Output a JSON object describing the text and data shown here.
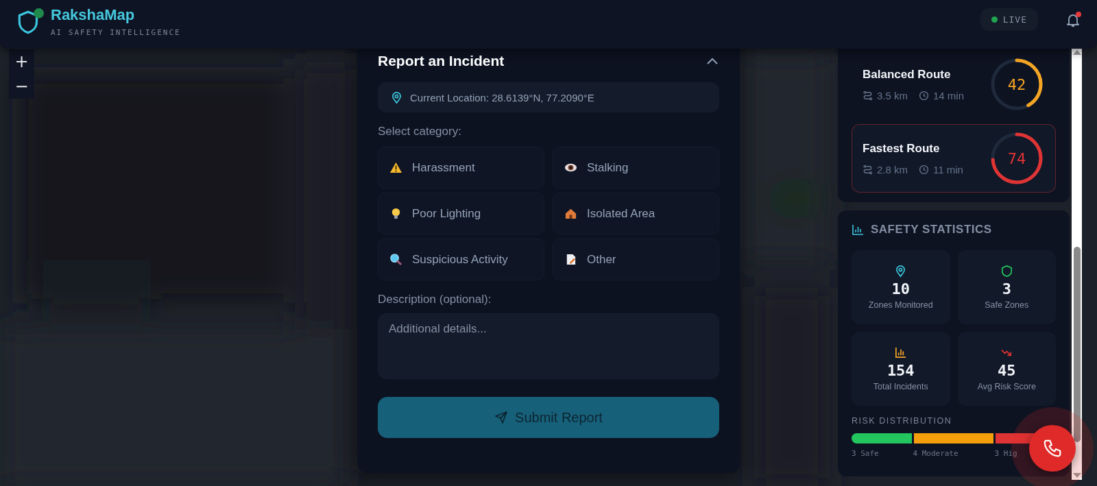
{
  "header": {
    "brand": "RakshaMap",
    "tagline": "AI SAFETY INTELLIGENCE",
    "live": "LIVE",
    "notifications": true
  },
  "map_controls": [
    "+",
    "−"
  ],
  "report": {
    "title": "Report an Incident",
    "location": "Current Location: 28.6139°N, 77.2090°E",
    "category_label": "Select category:",
    "categories": [
      {
        "kind": "warning",
        "label": "Harassment",
        "selected": false
      },
      {
        "kind": "eye",
        "label": "Stalking",
        "selected": false
      },
      {
        "kind": "bulb",
        "label": "Poor Lighting",
        "selected": false
      },
      {
        "kind": "house",
        "label": "Isolated Area",
        "selected": false
      },
      {
        "kind": "magnifier",
        "label": "Suspicious Activity",
        "selected": false
      },
      {
        "kind": "note",
        "label": "Other",
        "selected": false
      }
    ],
    "description_label": "Description (optional):",
    "description_placeholder": "Additional details...",
    "submit": "Submit Report"
  },
  "routes": [
    {
      "name": "Balanced Route",
      "distance": "3.5 km",
      "time": "14 min",
      "score": "42",
      "color": "#f5a524",
      "selected": false
    },
    {
      "name": "Fastest Route",
      "distance": "2.8 km",
      "time": "11 min",
      "score": "74",
      "color": "#e03434",
      "selected": true
    }
  ],
  "statistics": {
    "title": "SAFETY STATISTICS",
    "tiles": [
      {
        "kind": "pin",
        "color": "#3cc6de",
        "value": "10",
        "label": "Zones Monitored"
      },
      {
        "kind": "shield",
        "color": "#22c55e",
        "value": "3",
        "label": "Safe Zones"
      },
      {
        "kind": "bars",
        "color": "#f5a524",
        "value": "154",
        "label": "Total Incidents"
      },
      {
        "kind": "trend",
        "color": "#e03434",
        "value": "45",
        "label": "Avg Risk Score"
      }
    ],
    "distribution_title": "RISK DISTRIBUTION",
    "distribution": [
      {
        "count": "3",
        "label": "Safe",
        "color": "#22c55e"
      },
      {
        "count": "4",
        "label": "Moderate",
        "color": "#f59e0b"
      },
      {
        "count": "3",
        "label": "Hig",
        "color": "#e03434"
      }
    ]
  }
}
